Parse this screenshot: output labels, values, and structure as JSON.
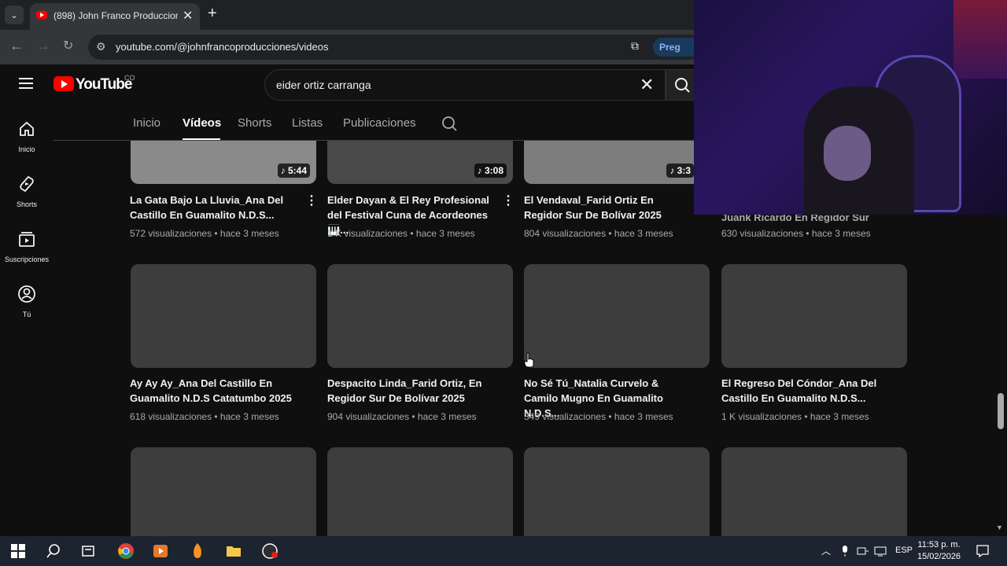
{
  "browser": {
    "tab_title": "(898) John Franco Produccione",
    "url": "youtube.com/@johnfrancoproducciones/videos",
    "ask_button": "Preg"
  },
  "youtube": {
    "wordmark": "YouTube",
    "country_code": "CO",
    "search_query": "eider ortiz carranga",
    "sidebar": {
      "items": [
        {
          "label": "Inicio",
          "icon": "home-icon"
        },
        {
          "label": "Shorts",
          "icon": "shorts-icon"
        },
        {
          "label": "Suscripciones",
          "icon": "subscriptions-icon"
        },
        {
          "label": "Tú",
          "icon": "you-icon"
        }
      ]
    },
    "channel_tabs": [
      "Inicio",
      "Videos",
      "Shorts",
      "Listas",
      "Publicaciones"
    ],
    "channel_tab_video_label": "Vídeos",
    "videos_row1": [
      {
        "title": "La Gata Bajo La Lluvia_Ana Del Castillo En Guamalito N.D.S...",
        "meta": "572 visualizaciones • hace 3 meses",
        "duration": "5:44"
      },
      {
        "title": "Elder Dayan & El Rey Profesional del Festival Cuna de Acordeones 🎹...",
        "meta": "1 K visualizaciones • hace 3 meses",
        "duration": "3:08"
      },
      {
        "title": "El Vendaval_Farid Ortiz En Regidor Sur De Bolívar 2025",
        "meta": "804 visualizaciones • hace 3 meses",
        "duration": "3:3"
      },
      {
        "title": "Juank Ricardo En Regidor Sur De...",
        "meta": "630 visualizaciones • hace 3 meses"
      }
    ],
    "videos_row2": [
      {
        "title": "Ay Ay Ay_Ana Del Castillo En Guamalito N.D.S Catatumbo 2025",
        "meta": "618 visualizaciones • hace 3 meses"
      },
      {
        "title": "Despacito Linda_Farid Ortiz, En Regidor Sur De Bolívar 2025",
        "meta": "904 visualizaciones • hace 3 meses"
      },
      {
        "title": "No Sé Tú_Natalia Curvelo & Camilo Mugno En Guamalito N.D.S...",
        "meta": "349 visualizaciones • hace 3 meses"
      },
      {
        "title": "El Regreso Del Cóndor_Ana Del Castillo En Guamalito N.D.S...",
        "meta": "1 K visualizaciones • hace 3 meses"
      }
    ]
  },
  "taskbar": {
    "language": "ESP",
    "time": "11:53 p. m.",
    "date": "15/02/2026"
  }
}
